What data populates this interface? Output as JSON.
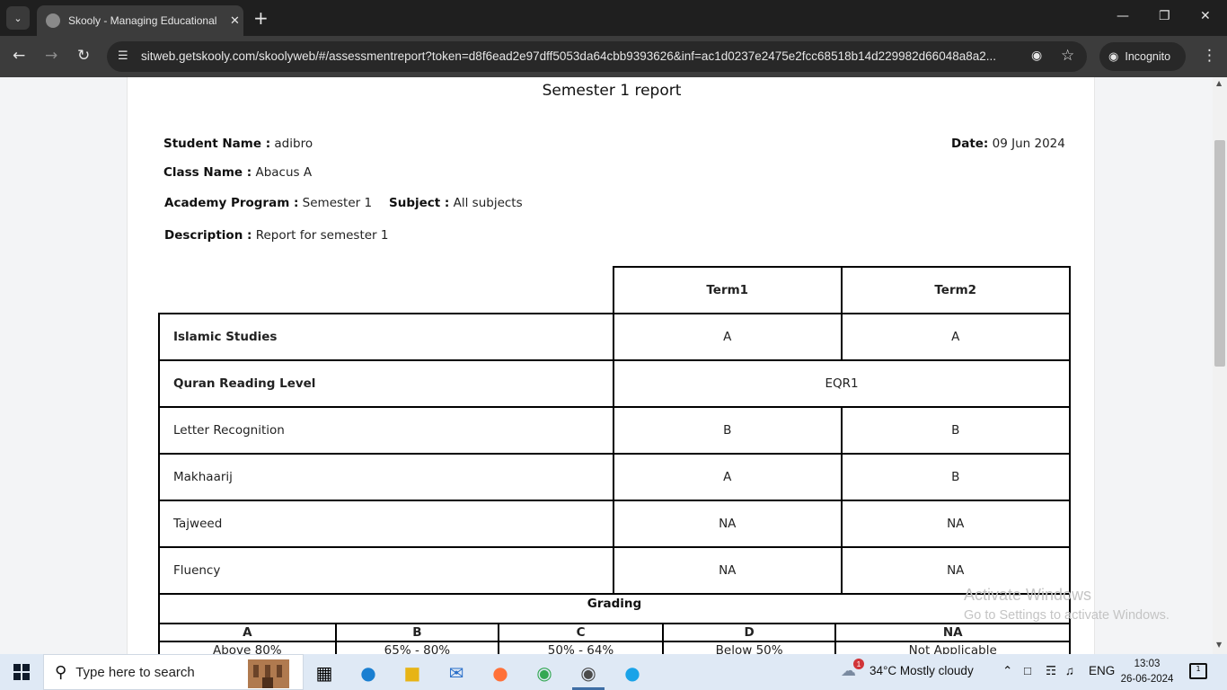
{
  "browser": {
    "tab_title": "Skooly - Managing Educational",
    "url": "sitweb.getskooly.com/skoolyweb/#/assessmentreport?token=d8f6ead2e97dff5053da64cbb9393626&inf=ac1d0237e2475e2fcc68518b14d229982d66048a8a2...",
    "incognito_label": "Incognito"
  },
  "report": {
    "title": "Semester 1 report",
    "student_name_label": "Student Name :",
    "student_name": "adibro",
    "date_label": "Date:",
    "date": "09 Jun 2024",
    "class_name_label": "Class Name :",
    "class_name": "Abacus A",
    "program_label": "Academy Program :",
    "program": "Semester 1",
    "subject_label": "Subject :",
    "subject": "All subjects",
    "description_label": "Description :",
    "description": "Report for semester 1",
    "columns": [
      "Term1",
      "Term2"
    ],
    "rows": [
      {
        "subject": "Islamic Studies",
        "term1": "A",
        "term2": "A"
      },
      {
        "subject": "Quran Reading Level",
        "merged": "EQR1"
      },
      {
        "subject": "Letter Recognition",
        "term1": "B",
        "term2": "B"
      },
      {
        "subject": "Makhaarij",
        "term1": "A",
        "term2": "B"
      },
      {
        "subject": "Tajweed",
        "term1": "NA",
        "term2": "NA"
      },
      {
        "subject": "Fluency",
        "term1": "NA",
        "term2": "NA"
      }
    ],
    "grading_title": "Grading",
    "grading_scale": [
      {
        "grade": "A",
        "range": "Above 80%"
      },
      {
        "grade": "B",
        "range": "65% - 80%"
      },
      {
        "grade": "C",
        "range": "50% - 64%"
      },
      {
        "grade": "D",
        "range": "Below 50%"
      },
      {
        "grade": "NA",
        "range": "Not Applicable"
      }
    ]
  },
  "watermark": {
    "line1": "Activate Windows",
    "line2": "Go to Settings to activate Windows."
  },
  "taskbar": {
    "search_placeholder": "Type here to search",
    "weather_badge": "1",
    "weather": "34°C  Mostly cloudy",
    "language": "ENG",
    "time": "13:03",
    "date": "26-06-2024",
    "notification_count": "1"
  }
}
